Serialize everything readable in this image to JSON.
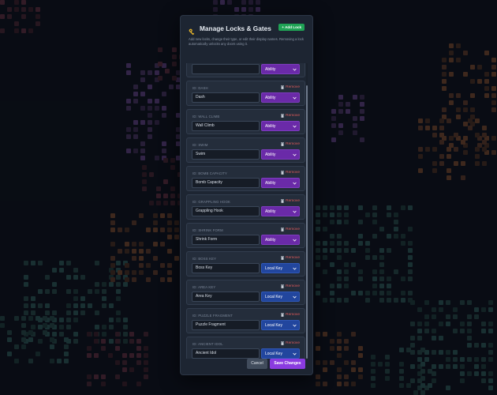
{
  "modal": {
    "title": "Manage Locks & Gates",
    "add_lock_label": "+ Add Lock",
    "description": "Add new locks, change their type, or edit their display names. Removing a lock automatically unlocks any doors using it.",
    "remove_label": "Remove",
    "locks": [
      {
        "id_label": "",
        "name": "",
        "type": "Ability"
      },
      {
        "id_label": "ID: DASH",
        "name": "Dash",
        "type": "Ability"
      },
      {
        "id_label": "ID: WALL CLIMB",
        "name": "Wall Climb",
        "type": "Ability"
      },
      {
        "id_label": "ID: SWIM",
        "name": "Swim",
        "type": "Ability"
      },
      {
        "id_label": "ID: BOMB CAPACITY",
        "name": "Bomb Capacity",
        "type": "Ability"
      },
      {
        "id_label": "ID: GRAPPLING HOOK",
        "name": "Grappling Hook",
        "type": "Ability"
      },
      {
        "id_label": "ID: SHRINK FORM",
        "name": "Shrink Form",
        "type": "Ability"
      },
      {
        "id_label": "ID: BOSS KEY",
        "name": "Boss Key",
        "type": "Local Key"
      },
      {
        "id_label": "ID: AREA KEY",
        "name": "Area Key",
        "type": "Local Key"
      },
      {
        "id_label": "ID: PUZZLE FRAGMENT",
        "name": "Puzzle Fragment",
        "type": "Local Key"
      },
      {
        "id_label": "ID: ANCIENT IDOL",
        "name": "Ancient Idol",
        "type": "Local Key"
      }
    ],
    "cancel_label": "Cancel",
    "save_label": "Save Changes"
  },
  "colors": {
    "ability": "#6a2aa8",
    "local_key": "#22469e",
    "remove": "#e05a5a",
    "add": "#1fa355",
    "save": "#8a3be0"
  }
}
